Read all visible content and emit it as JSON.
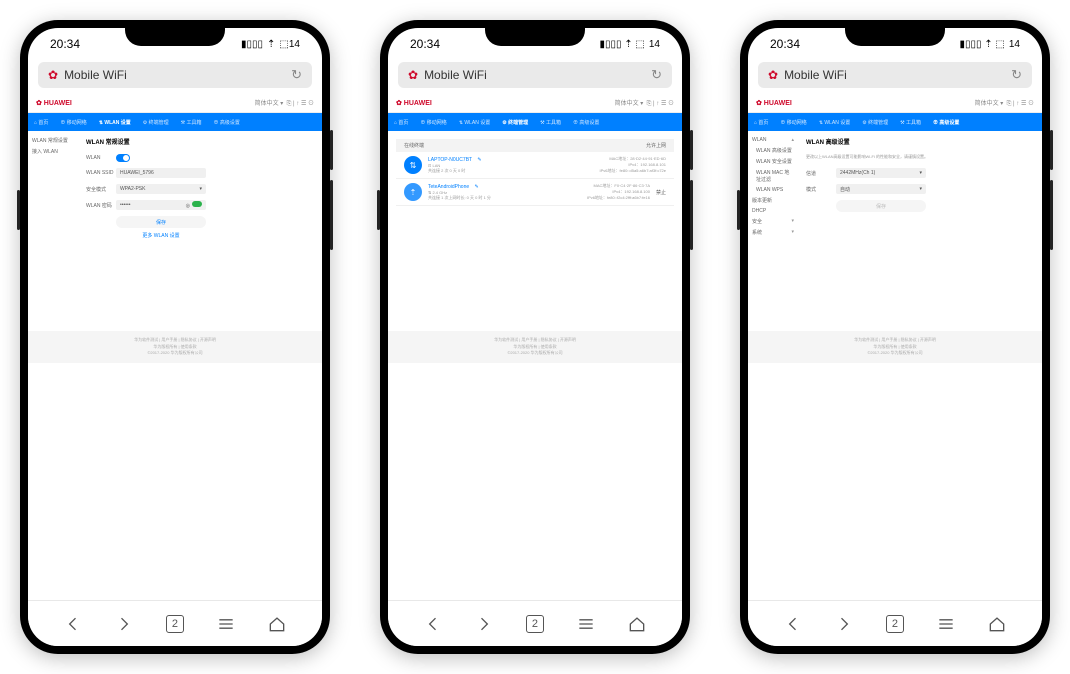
{
  "status": {
    "time": "20:34",
    "battery": "14"
  },
  "url_bar": {
    "brand": "✿",
    "title": "Mobile WiFi"
  },
  "app_header": {
    "brand": "✿ HUAWEI",
    "lang": "简体中文 ▾",
    "icons": "⎘ | ↑ ☰ ⊙"
  },
  "nav": {
    "home": "⌂ 首页",
    "stats": "⊕ 移动网络",
    "wlan": "⇅ WLAN 设置",
    "devices": "⚙ 终端管理",
    "tools": "⚒ 工具箱",
    "advanced": "⊕ 高级设置"
  },
  "screen1": {
    "side": {
      "a": "WLAN 常规设置",
      "b": "接入 WLAN"
    },
    "title": "WLAN 常规设置",
    "rows": {
      "wlan": "WLAN",
      "ssid": "WLAN SSID",
      "ssid_val": "HUAWEI_5796",
      "sec": "安全模式",
      "sec_val": "WPA2-PSK",
      "pwd": "WLAN 密码",
      "pwd_val": "••••••"
    },
    "save": "保存",
    "more": "更多 WLAN 设置"
  },
  "screen2": {
    "col1": "在线终端",
    "col2": "允许上网",
    "dev1": {
      "name": "LAPTOP-N0UC7BT",
      "tag": "⊡ LAN",
      "line": "共连接 2 次 0 天 0 时",
      "mac": "MAC地址：28·D2·44·91·ED·6D",
      "ip4": "IPv4：192.168.8.101",
      "ip6": "IPv6地址：fe80::d5a5:a6b7:af3f:c72e"
    },
    "dev2": {
      "name": "TeteAndroidPhone",
      "tag": "⇅ 2.4 GHz",
      "line": "共连接 1 次上网时长: 0 天 0 时 1 分",
      "mac": "MAC地址：F0·C4·2F·86·C3·7A",
      "ip4": "IPv4：192.168.8.100",
      "ip6": "IPv6地址：fe80::f2c4:2fff:a6b7:fe16",
      "block": "禁止"
    }
  },
  "screen3": {
    "side": {
      "wlan": "WLAN",
      "wlan_adv": "WLAN 高级设置",
      "wlan_sec": "WLAN 安全设置",
      "wlan_mac": "WLAN MAC 地址过滤",
      "wlan_wps": "WLAN WPS",
      "upd": "版本更新",
      "dhcp": "DHCP",
      "sec": "安全",
      "sys": "系统"
    },
    "title": "WLAN 高级设置",
    "desc": "更改以上WLAN高级设置可能影响Wi-Fi 的性能和安全，请谨慎设置。",
    "row1_lbl": "信道",
    "row1_val": "2442MHz(Ch 1)",
    "row2_lbl": "模式",
    "row2_val": "自动",
    "save": "保存"
  },
  "footer": {
    "line1": "华为软件测试 | 用户手册 | 隐私协议 | 开源声明",
    "line2": "华为版权所有 | 使用条款",
    "line3": "©2017-2020 华为版权所有公司"
  },
  "tabs": "2"
}
